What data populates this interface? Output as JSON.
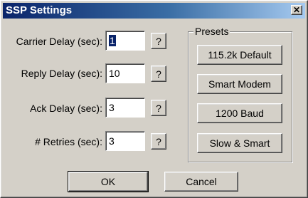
{
  "window": {
    "title": "SSP Settings",
    "close_glyph": "✕"
  },
  "fields": [
    {
      "label": "Carrier Delay (sec):",
      "value": "1",
      "help": "?"
    },
    {
      "label": "Reply Delay (sec):",
      "value": "10",
      "help": "?"
    },
    {
      "label": "Ack Delay (sec):",
      "value": "3",
      "help": "?"
    },
    {
      "label": "# Retries (sec):",
      "value": "3",
      "help": "?"
    }
  ],
  "presets": {
    "title": "Presets",
    "buttons": [
      "115.2k Default",
      "Smart Modem",
      "1200 Baud",
      "Slow & Smart"
    ]
  },
  "actions": {
    "ok": "OK",
    "cancel": "Cancel"
  }
}
